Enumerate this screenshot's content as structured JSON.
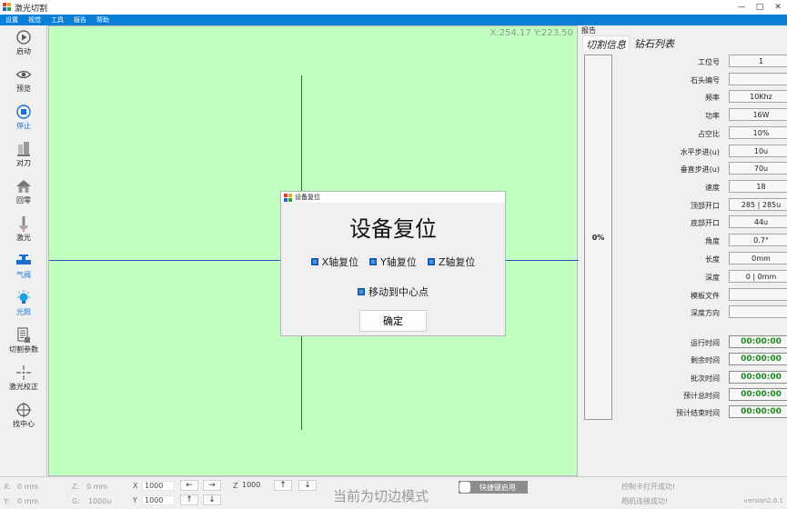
{
  "window": {
    "title": "激光切割",
    "minimize": "—",
    "maximize": "□",
    "close": "✕"
  },
  "menu": [
    "设置",
    "视觉",
    "工具",
    "报告",
    "帮助"
  ],
  "toolbar": [
    {
      "label": "启动",
      "icon": "play-icon"
    },
    {
      "label": "预览",
      "icon": "eye-icon"
    },
    {
      "label": "停止",
      "icon": "stop-icon"
    },
    {
      "label": "对刀",
      "icon": "align-tool-icon"
    },
    {
      "label": "回零",
      "icon": "home-icon"
    },
    {
      "label": "激光",
      "icon": "laser-icon"
    },
    {
      "label": "气阀",
      "icon": "valve-icon"
    },
    {
      "label": "光照",
      "icon": "light-icon"
    },
    {
      "label": "切割参数",
      "icon": "document-icon"
    },
    {
      "label": "激光校正",
      "icon": "calibrate-icon"
    },
    {
      "label": "找中心",
      "icon": "crosshair-icon"
    }
  ],
  "canvas": {
    "coords": "X:254.17 Y:223.50"
  },
  "dialog": {
    "title": "设备复位",
    "heading": "设备复位",
    "checks": [
      "X轴复位",
      "Y轴复位",
      "Z轴复位"
    ],
    "center_check": "移动到中心点",
    "ok": "确定"
  },
  "report": {
    "title": "报告",
    "tabs": [
      "切割信息",
      "钻石列表"
    ],
    "progress": "0%",
    "rows": [
      {
        "label": "工位号",
        "value": "1"
      },
      {
        "label": "石头编号",
        "value": ""
      },
      {
        "label": "频率",
        "value": "10Khz"
      },
      {
        "label": "功率",
        "value": "16W"
      },
      {
        "label": "占空比",
        "value": "10%"
      },
      {
        "label": "水平步进(u)",
        "value": "10u"
      },
      {
        "label": "垂直步进(u)",
        "value": "70u"
      },
      {
        "label": "速度",
        "value": "18"
      },
      {
        "label": "顶部开口",
        "value": "285 | 285u"
      },
      {
        "label": "底部开口",
        "value": "44u"
      },
      {
        "label": "角度",
        "value": "0.7°"
      },
      {
        "label": "长度",
        "value": "0mm"
      },
      {
        "label": "深度",
        "value": "0 | 0mm"
      },
      {
        "label": "模板文件",
        "value": ""
      },
      {
        "label": "深度方向",
        "value": ""
      }
    ],
    "times": [
      {
        "label": "运行时间",
        "value": "00:00:00"
      },
      {
        "label": "剩余时间",
        "value": "00:00:00"
      },
      {
        "label": "批次时间",
        "value": "00:00:00"
      },
      {
        "label": "预计总时间",
        "value": "00:00:00"
      },
      {
        "label": "预计结束时间",
        "value": "00:00:00"
      }
    ]
  },
  "bottom": {
    "x_label": "X:",
    "x_value": "0 mm",
    "y_label": "Y:",
    "y_value": "0 mm",
    "z_label": "Z:",
    "z_value": "0 mm",
    "g_label": "G:",
    "g_value": "1000u",
    "jog_x_label": "X",
    "jog_x_value": "1000",
    "jog_y_label": "Y",
    "jog_y_value": "1000",
    "jog_z_label": "Z",
    "jog_z_value": "1000",
    "left_arrow": "←",
    "right_arrow": "→",
    "up_arrow": "↑",
    "down_arrow": "↓",
    "mode": "当前为切边模式",
    "hotkey": "快捷键启用",
    "status1": "控制卡打开成功!",
    "status2": "相机连接成功!",
    "version": "version2.6.1"
  }
}
